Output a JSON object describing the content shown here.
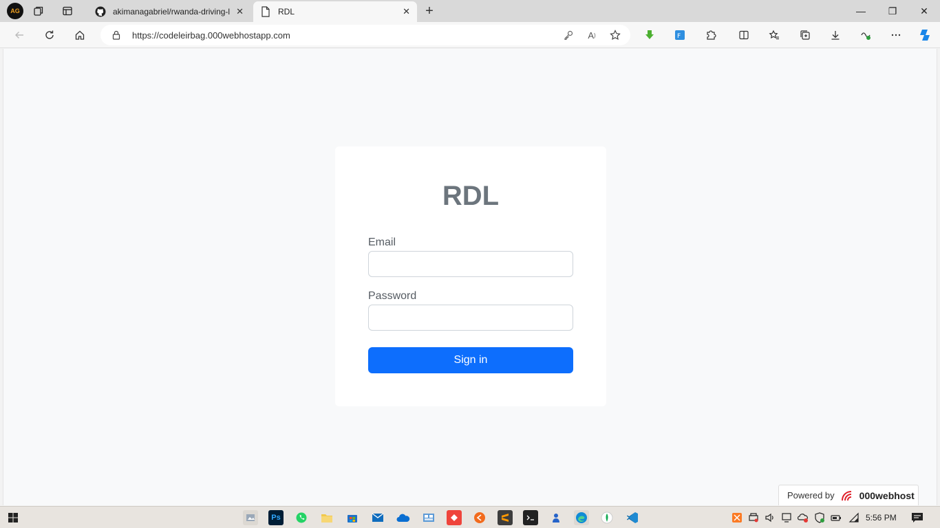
{
  "browser": {
    "profile_initials": "AG",
    "tabs": [
      {
        "title": "akimanagabriel/rwanda-driving-l",
        "close": "✕"
      },
      {
        "title": "RDL",
        "close": "✕"
      }
    ],
    "new_tab": "+",
    "window_controls": {
      "minimize": "—",
      "maximize": "❐",
      "close": "✕"
    },
    "url": "https://codeleirbag.000webhostapp.com"
  },
  "page": {
    "title": "RDL",
    "email_label": "Email",
    "email_value": "",
    "password_label": "Password",
    "password_value": "",
    "submit_label": "Sign in",
    "powered_by": "Powered by",
    "host_brand": "000webhost"
  },
  "taskbar": {
    "clock": "5:56 PM",
    "apps": [
      "file-explorer-tiles",
      "photoshop",
      "whatsapp",
      "file-explorer",
      "microsoft-store",
      "mail",
      "onedrive",
      "control-panel",
      "anydesk",
      "app-orange",
      "sublime-text",
      "terminal",
      "teams-user",
      "edge",
      "mongodb-compass",
      "vscode"
    ]
  },
  "colors": {
    "primary": "#0d6efd",
    "title": "#6c757d",
    "page_bg": "#f8f9fa"
  }
}
